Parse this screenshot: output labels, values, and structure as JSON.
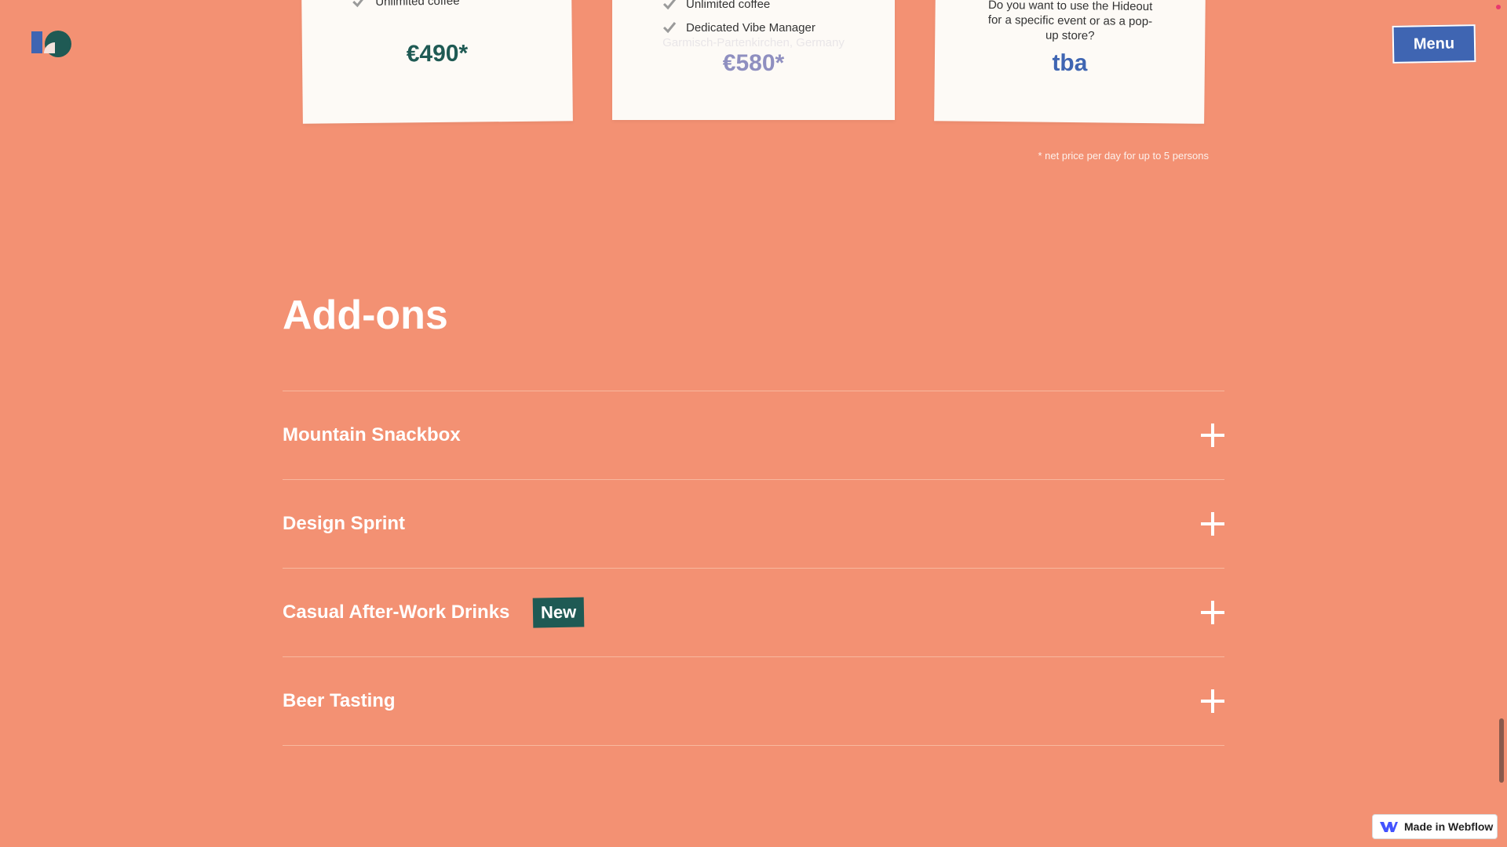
{
  "header": {
    "logo_name": "hideout-logo",
    "menu_label": "Menu"
  },
  "pricing": {
    "cards": [
      {
        "feature_partial": "Unlimited coffee",
        "price": "€490*"
      },
      {
        "feature_partial": "Unlimited coffee",
        "feature": "Dedicated Vibe Manager",
        "location_ghost": "Garmisch-Partenkirchen, Germany",
        "price": "€580*"
      },
      {
        "question": "Do you want to use the Hideout for a specific event or as a pop-up store?",
        "price": "tba"
      }
    ],
    "footnote": "* net price per day for up to 5 persons"
  },
  "addons": {
    "title": "Add-ons",
    "items": [
      {
        "label": "Mountain Snackbox",
        "badge": ""
      },
      {
        "label": "Design Sprint",
        "badge": ""
      },
      {
        "label": "Casual After-Work Drinks",
        "badge": "New"
      },
      {
        "label": "Beer Tasting",
        "badge": ""
      }
    ]
  },
  "footer": {
    "webflow_badge": "Made in Webflow"
  },
  "colors": {
    "background": "#f39173",
    "menu_button": "#3f65b2",
    "badge_new": "#1f5a54",
    "price_teal": "#1f5a54",
    "price_blue": "#3f65b2"
  }
}
